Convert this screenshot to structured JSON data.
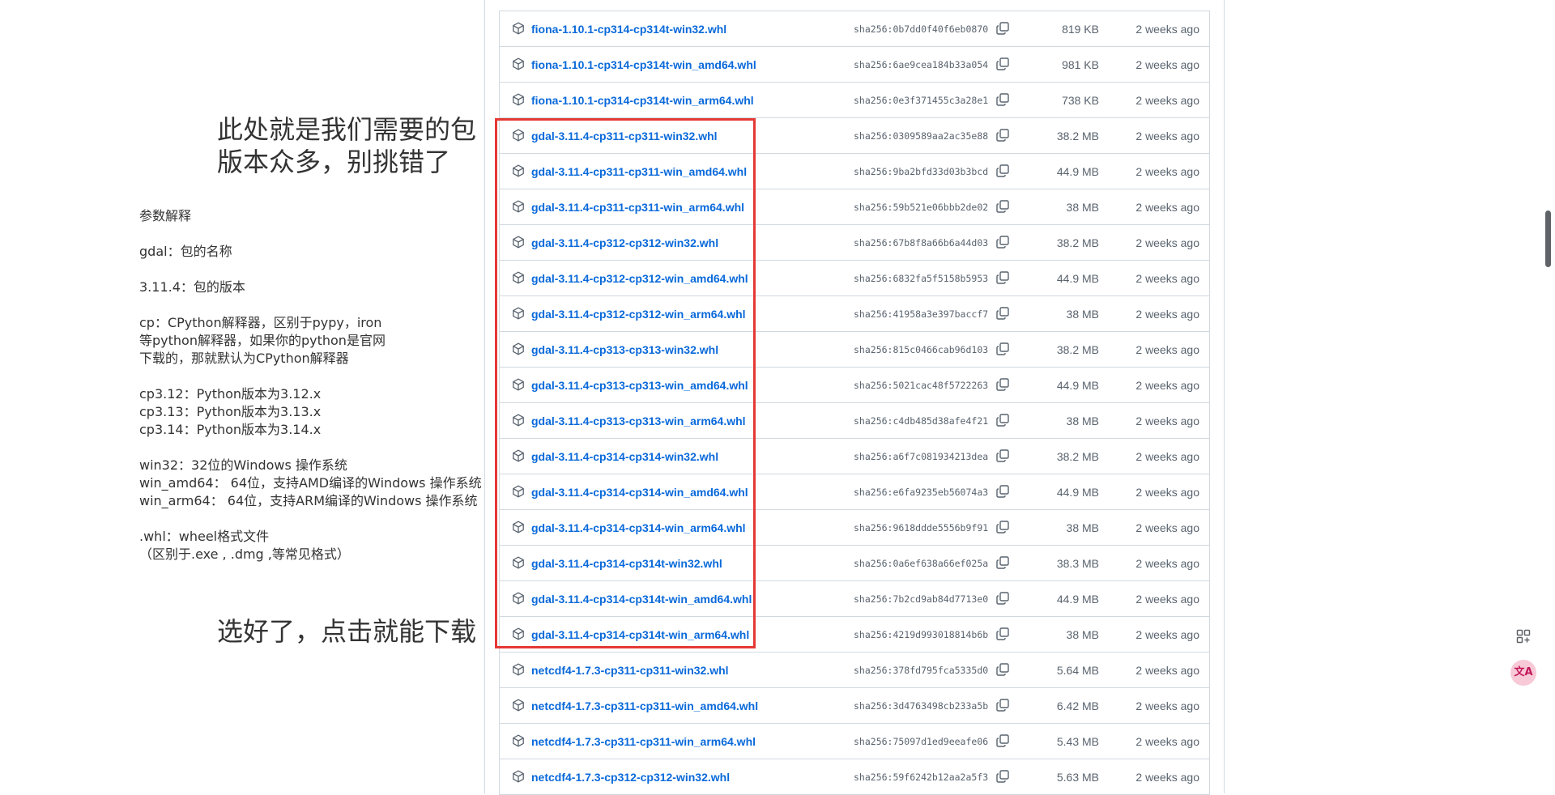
{
  "annotations": {
    "heading_line1": "此处就是我们需要的包",
    "heading_line2": "版本众多，别挑错了",
    "footer": "选好了，点击就能下载",
    "explanation": [
      "参数解释",
      "",
      "gdal：包的名称",
      "",
      "3.11.4：包的版本",
      "",
      "cp：CPython解释器，区别于pypy，iron",
      "等python解释器，如果你的python是官网",
      "下载的，那就默认为CPython解释器",
      "",
      "cp3.12：Python版本为3.12.x",
      "cp3.13：Python版本为3.13.x",
      "cp3.14：Python版本为3.14.x",
      "",
      "win32：32位的Windows 操作系统",
      "win_amd64：  64位，支持AMD编译的Windows 操作系统",
      "win_arm64：  64位，支持ARM编译的Windows 操作系统",
      "",
      ".whl：wheel格式文件",
      "（区别于.exe , .dmg ,等常见格式）"
    ]
  },
  "files": [
    {
      "name": "fiona-1.10.1-cp314-cp314t-win32.whl",
      "hash": "sha256:0b7dd0f40f6eb0870",
      "size": "819 KB",
      "date": "2 weeks ago"
    },
    {
      "name": "fiona-1.10.1-cp314-cp314t-win_amd64.whl",
      "hash": "sha256:6ae9cea184b33a054",
      "size": "981 KB",
      "date": "2 weeks ago"
    },
    {
      "name": "fiona-1.10.1-cp314-cp314t-win_arm64.whl",
      "hash": "sha256:0e3f371455c3a28e1",
      "size": "738 KB",
      "date": "2 weeks ago"
    },
    {
      "name": "gdal-3.11.4-cp311-cp311-win32.whl",
      "hash": "sha256:0309589aa2ac35e88",
      "size": "38.2 MB",
      "date": "2 weeks ago"
    },
    {
      "name": "gdal-3.11.4-cp311-cp311-win_amd64.whl",
      "hash": "sha256:9ba2bfd33d03b3bcd",
      "size": "44.9 MB",
      "date": "2 weeks ago"
    },
    {
      "name": "gdal-3.11.4-cp311-cp311-win_arm64.whl",
      "hash": "sha256:59b521e06bbb2de02",
      "size": "38 MB",
      "date": "2 weeks ago"
    },
    {
      "name": "gdal-3.11.4-cp312-cp312-win32.whl",
      "hash": "sha256:67b8f8a66b6a44d03",
      "size": "38.2 MB",
      "date": "2 weeks ago"
    },
    {
      "name": "gdal-3.11.4-cp312-cp312-win_amd64.whl",
      "hash": "sha256:6832fa5f5158b5953",
      "size": "44.9 MB",
      "date": "2 weeks ago"
    },
    {
      "name": "gdal-3.11.4-cp312-cp312-win_arm64.whl",
      "hash": "sha256:41958a3e397baccf7",
      "size": "38 MB",
      "date": "2 weeks ago"
    },
    {
      "name": "gdal-3.11.4-cp313-cp313-win32.whl",
      "hash": "sha256:815c0466cab96d103",
      "size": "38.2 MB",
      "date": "2 weeks ago"
    },
    {
      "name": "gdal-3.11.4-cp313-cp313-win_amd64.whl",
      "hash": "sha256:5021cac48f5722263",
      "size": "44.9 MB",
      "date": "2 weeks ago"
    },
    {
      "name": "gdal-3.11.4-cp313-cp313-win_arm64.whl",
      "hash": "sha256:c4db485d38afe4f21",
      "size": "38 MB",
      "date": "2 weeks ago"
    },
    {
      "name": "gdal-3.11.4-cp314-cp314-win32.whl",
      "hash": "sha256:a6f7c081934213dea",
      "size": "38.2 MB",
      "date": "2 weeks ago"
    },
    {
      "name": "gdal-3.11.4-cp314-cp314-win_amd64.whl",
      "hash": "sha256:e6fa9235eb56074a3",
      "size": "44.9 MB",
      "date": "2 weeks ago"
    },
    {
      "name": "gdal-3.11.4-cp314-cp314-win_arm64.whl",
      "hash": "sha256:9618ddde5556b9f91",
      "size": "38 MB",
      "date": "2 weeks ago"
    },
    {
      "name": "gdal-3.11.4-cp314-cp314t-win32.whl",
      "hash": "sha256:0a6ef638a66ef025a",
      "size": "38.3 MB",
      "date": "2 weeks ago"
    },
    {
      "name": "gdal-3.11.4-cp314-cp314t-win_amd64.whl",
      "hash": "sha256:7b2cd9ab84d7713e0",
      "size": "44.9 MB",
      "date": "2 weeks ago"
    },
    {
      "name": "gdal-3.11.4-cp314-cp314t-win_arm64.whl",
      "hash": "sha256:4219d993018814b6b",
      "size": "38 MB",
      "date": "2 weeks ago"
    },
    {
      "name": "netcdf4-1.7.3-cp311-cp311-win32.whl",
      "hash": "sha256:378fd795fca5335d0",
      "size": "5.64 MB",
      "date": "2 weeks ago"
    },
    {
      "name": "netcdf4-1.7.3-cp311-cp311-win_amd64.whl",
      "hash": "sha256:3d4763498cb233a5b",
      "size": "6.42 MB",
      "date": "2 weeks ago"
    },
    {
      "name": "netcdf4-1.7.3-cp311-cp311-win_arm64.whl",
      "hash": "sha256:75097d1ed9eeafe06",
      "size": "5.43 MB",
      "date": "2 weeks ago"
    },
    {
      "name": "netcdf4-1.7.3-cp312-cp312-win32.whl",
      "hash": "sha256:59f6242b12aa2a5f3",
      "size": "5.63 MB",
      "date": "2 weeks ago"
    }
  ],
  "highlight": {
    "color": "#e53935"
  },
  "icons": {
    "row_icon": "package-icon",
    "copy_icon": "copy-icon",
    "float_top": "apps-add-icon",
    "float_bottom": "translate-icon"
  },
  "translate_glyph": "文A"
}
